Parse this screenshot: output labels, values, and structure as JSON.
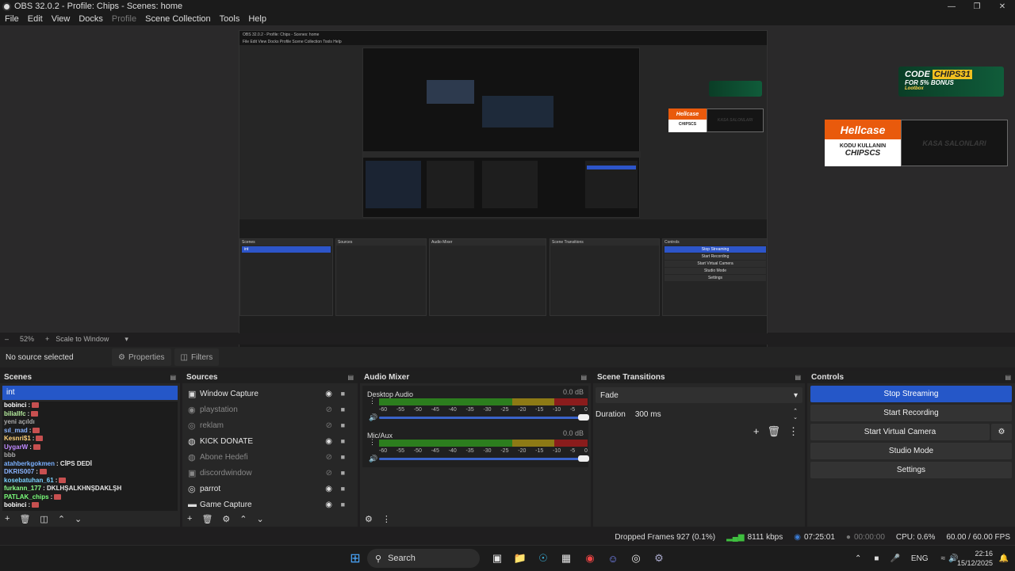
{
  "window": {
    "title": "OBS 32.0.2 - Profile: Chips - Scenes: home"
  },
  "menu": [
    "File",
    "Edit",
    "View",
    "Docks",
    "Profile",
    "Scene Collection",
    "Tools",
    "Help"
  ],
  "overlays": {
    "code_banner": {
      "line1": "CODE",
      "code": "CHIPS31",
      "line2": "FOR 5% BONUS",
      "brand": "Lootbox"
    },
    "hellcase": {
      "logo": "Hellcase",
      "line1": "KODU KULLANIN",
      "line2": "CHIPSCS",
      "right": "KASA SALONLARI"
    },
    "mini_title": "OBS 32.0.2 - Profile: Chips - Scenes: home",
    "mini_menu": "File  Edit  View  Docks  Profile  Scene Collection  Tools  Help"
  },
  "zoombar": {
    "zoom": "52%",
    "scale": "Scale to Window"
  },
  "context": {
    "no_selection": "No source selected",
    "properties": "Properties",
    "filters": "Filters"
  },
  "scenes": {
    "title": "Scenes",
    "selected": "int",
    "chat": [
      {
        "user": "bobinci",
        "msg": ":",
        "color": "#ffffff"
      },
      {
        "user": "biliallfc",
        "msg": ":",
        "color": "#b8f0a0"
      },
      {
        "user": "yeni açıldı",
        "msg": "",
        "color": "#aaaaaa"
      },
      {
        "user": "sıl_mad",
        "msg": ":",
        "color": "#8ab4ff"
      },
      {
        "user": "Kesnri$1",
        "msg": ":",
        "color": "#ffd27a"
      },
      {
        "user": "UygarW",
        "msg": ":",
        "color": "#c08aff"
      },
      {
        "user": "bbb",
        "msg": "",
        "color": "#aaaaaa"
      },
      {
        "user": "atahberkgokmen",
        "msg": ": CİPS DEDİ",
        "color": "#7ab0ff"
      },
      {
        "user": "DKRIS007",
        "msg": ":",
        "color": "#8ab4ff"
      },
      {
        "user": "kosebatuhan_61",
        "msg": ":",
        "color": "#7ad0ff"
      },
      {
        "user": "furkann_177",
        "msg": ": DKLHŞALKHNŞDAKLŞH",
        "color": "#8aff8a"
      },
      {
        "user": "PATLAK_chips",
        "msg": ":",
        "color": "#7aff7a"
      },
      {
        "user": "bobinci",
        "msg": ":",
        "color": "#ffffff"
      }
    ]
  },
  "sources": {
    "title": "Sources",
    "items": [
      {
        "name": "Window Capture",
        "icon": "window-icon",
        "visible": true
      },
      {
        "name": "playstation",
        "icon": "camera-icon",
        "visible": false
      },
      {
        "name": "reklam",
        "icon": "media-icon",
        "visible": false
      },
      {
        "name": "KICK DONATE",
        "icon": "globe-icon",
        "visible": true
      },
      {
        "name": "Abone Hedefi",
        "icon": "globe-icon",
        "visible": false
      },
      {
        "name": "discordwindow",
        "icon": "window-icon",
        "visible": false
      },
      {
        "name": "parrot",
        "icon": "media-icon",
        "visible": true
      },
      {
        "name": "Game Capture",
        "icon": "gamepad-icon",
        "visible": true
      }
    ]
  },
  "mixer": {
    "title": "Audio Mixer",
    "channels": [
      {
        "name": "Desktop Audio",
        "db": "0.0 dB"
      },
      {
        "name": "Mic/Aux",
        "db": "0.0 dB"
      }
    ],
    "ticks": [
      "-60",
      "-55",
      "-50",
      "-45",
      "-40",
      "-35",
      "-30",
      "-25",
      "-20",
      "-15",
      "-10",
      "-5",
      "0"
    ]
  },
  "transitions": {
    "title": "Scene Transitions",
    "type": "Fade",
    "duration_label": "Duration",
    "duration": "300 ms"
  },
  "controls": {
    "title": "Controls",
    "stop_streaming": "Stop Streaming",
    "start_recording": "Start Recording",
    "start_virtual_camera": "Start Virtual Camera",
    "studio_mode": "Studio Mode",
    "settings": "Settings"
  },
  "status": {
    "dropped": "Dropped Frames 927 (0.1%)",
    "bitrate": "8111 kbps",
    "stream_time": "07:25:01",
    "rec_time": "00:00:00",
    "cpu": "CPU: 0.6%",
    "fps": "60.00 / 60.00 FPS"
  },
  "taskbar": {
    "search": "Search",
    "lang": "ENG",
    "time": "22:16",
    "date": "15/12/2025"
  },
  "colors": {
    "accent": "#2557c8",
    "hellcase_orange": "#e95a0c"
  }
}
